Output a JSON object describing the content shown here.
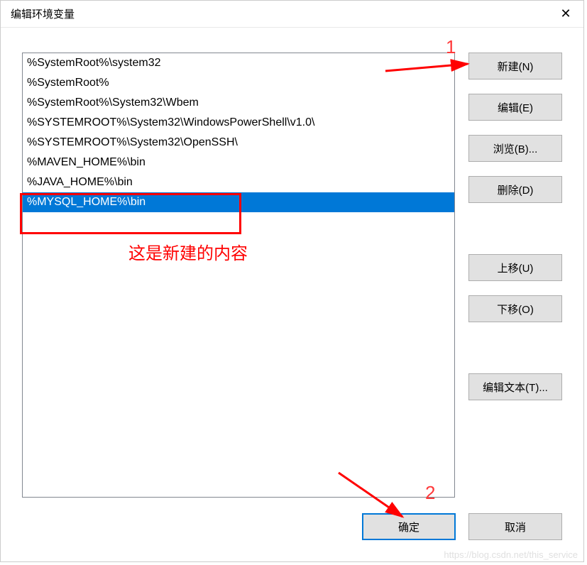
{
  "title": "编辑环境变量",
  "list_items": [
    "%SystemRoot%\\system32",
    "%SystemRoot%",
    "%SystemRoot%\\System32\\Wbem",
    "%SYSTEMROOT%\\System32\\WindowsPowerShell\\v1.0\\",
    "%SYSTEMROOT%\\System32\\OpenSSH\\",
    "%MAVEN_HOME%\\bin",
    "%JAVA_HOME%\\bin",
    "%MYSQL_HOME%\\bin"
  ],
  "selected_index": 7,
  "buttons": {
    "new": "新建(N)",
    "edit": "编辑(E)",
    "browse": "浏览(B)...",
    "delete": "删除(D)",
    "moveup": "上移(U)",
    "movedown": "下移(O)",
    "edittext": "编辑文本(T)...",
    "ok": "确定",
    "cancel": "取消"
  },
  "annotation": {
    "text": "这是新建的内容",
    "num1": "1",
    "num2": "2"
  },
  "watermark": "https://blog.csdn.net/this_service"
}
